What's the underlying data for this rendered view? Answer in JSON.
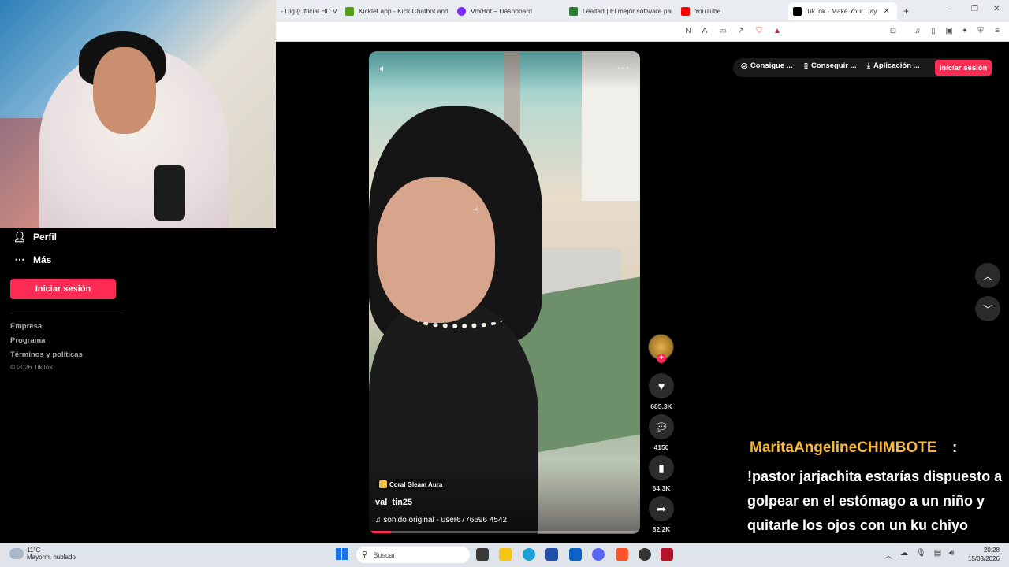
{
  "browser": {
    "tabs": [
      {
        "label": "- Dig (Official HD V",
        "color": "#888888"
      },
      {
        "label": "Kicklet.app - Kick Chatbot and",
        "color": "#53a018"
      },
      {
        "label": "VoxBot – Dashboard",
        "color": "#7b2ff7"
      },
      {
        "label": "Lealtad | El mejor software par",
        "color": "#2e7d32"
      },
      {
        "label": "YouTube",
        "color": "#ff0000"
      },
      {
        "label": "TikTok - Make Your Day",
        "color": "#000000"
      }
    ],
    "new_tab": "+",
    "tab_close": "✕"
  },
  "sidebar": {
    "items": [
      {
        "label": "Perfil",
        "icon": "person-icon"
      },
      {
        "label": "Más",
        "icon": "more-icon"
      }
    ],
    "login_button": "Iniciar sesión",
    "footer_links": [
      "Empresa",
      "Programa",
      "Términos y políticas"
    ],
    "copyright": "© 2026 TikTok"
  },
  "header": {
    "buttons": [
      {
        "label": "Consigue ...",
        "icon": "coin-icon"
      },
      {
        "label": "Conseguir ...",
        "icon": "phone-icon"
      },
      {
        "label": "Aplicación ...",
        "icon": "download-icon"
      }
    ],
    "login_button": "Iniciar sesión",
    "accent": "#fe2c55"
  },
  "video": {
    "effect_label": "Coral Gleam Aura",
    "author": "val_tin25",
    "music": "sonido original - user6776696 4542",
    "progress": 0.08
  },
  "actions": {
    "likes": "685.3K",
    "comments": "4150",
    "saves": "64.3K",
    "shares": "82.2K"
  },
  "chat": {
    "username": "MaritaAngelineCHIMBOTE",
    "colon": ":",
    "message": "!pastor jarjachita estarías dispuesto a golpear en el estómago a un niño y quitarle los ojos con un ku chiyo"
  },
  "taskbar": {
    "weather_temp": "11°C",
    "weather_desc": "Mayorm. nublado",
    "search_placeholder": "Buscar",
    "time": "20:28",
    "date": "15/03/2026"
  }
}
